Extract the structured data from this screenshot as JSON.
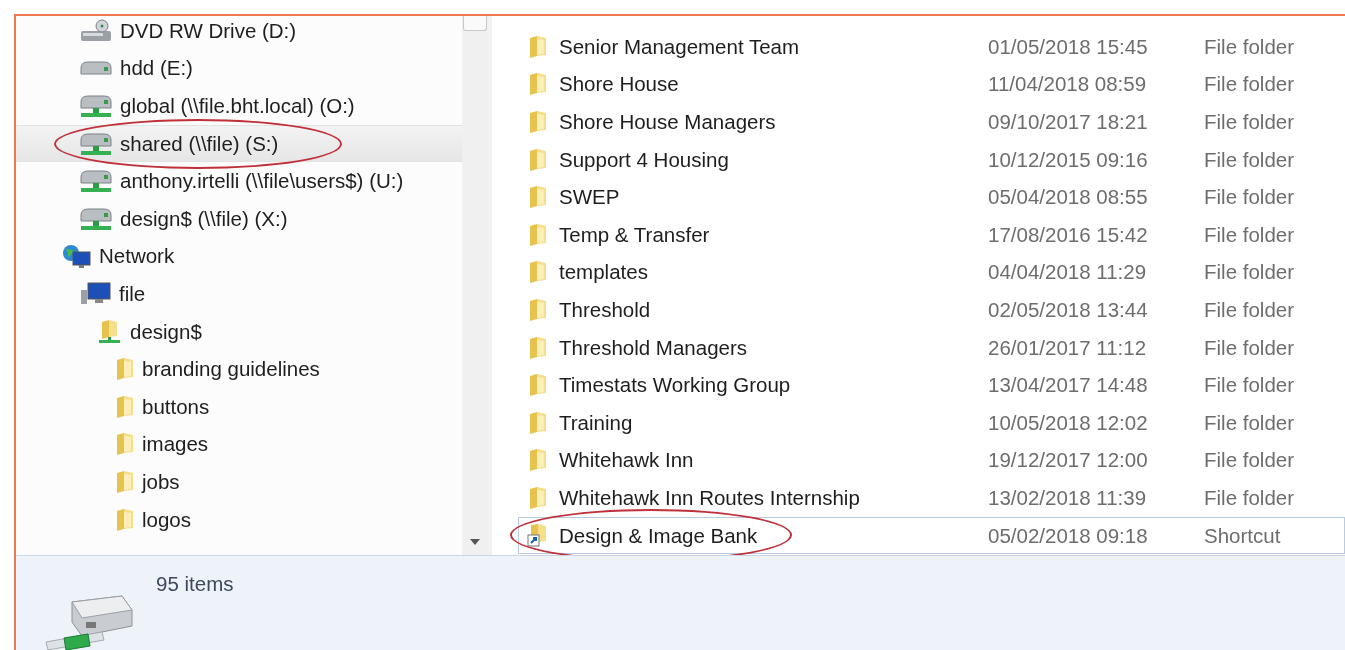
{
  "navigation_pane": {
    "drives": [
      {
        "label": "DVD RW Drive (D:)",
        "kind": "dvd",
        "selected": false,
        "annotated": false
      },
      {
        "label": "hdd (E:)",
        "kind": "hdd",
        "selected": false,
        "annotated": false
      },
      {
        "label": "global (\\\\file.bht.local) (O:)",
        "kind": "netdrive",
        "selected": false,
        "annotated": false
      },
      {
        "label": "shared (\\\\file) (S:)",
        "kind": "netdrive",
        "selected": true,
        "annotated": true
      },
      {
        "label": "anthony.irtelli (\\\\file\\users$) (U:)",
        "kind": "netdrive",
        "selected": false,
        "annotated": false
      },
      {
        "label": "design$ (\\\\file) (X:)",
        "kind": "netdrive",
        "selected": false,
        "annotated": false
      }
    ],
    "tree": [
      {
        "label": "Network",
        "kind": "network",
        "selected": false,
        "annotated": false,
        "children": [
          {
            "label": "file",
            "kind": "computer",
            "selected": false,
            "annotated": false,
            "children": [
              {
                "label": "design$",
                "kind": "share",
                "selected": false,
                "annotated": false,
                "children": [
                  {
                    "label": "branding guidelines",
                    "kind": "folder",
                    "selected": false,
                    "annotated": false
                  },
                  {
                    "label": "buttons",
                    "kind": "folder",
                    "selected": false,
                    "annotated": false
                  },
                  {
                    "label": "images",
                    "kind": "folder",
                    "selected": false,
                    "annotated": false
                  },
                  {
                    "label": "jobs",
                    "kind": "folder",
                    "selected": false,
                    "annotated": false
                  },
                  {
                    "label": "logos",
                    "kind": "folder",
                    "selected": false,
                    "annotated": false
                  }
                ]
              }
            ]
          }
        ]
      }
    ]
  },
  "file_list": {
    "rows": [
      {
        "name": "Senior Management Team",
        "date_modified": "01/05/2018 15:45",
        "type": "File folder",
        "kind": "folder",
        "selected": false,
        "annotated": false
      },
      {
        "name": "Shore House",
        "date_modified": "11/04/2018 08:59",
        "type": "File folder",
        "kind": "folder",
        "selected": false,
        "annotated": false
      },
      {
        "name": "Shore House Managers",
        "date_modified": "09/10/2017 18:21",
        "type": "File folder",
        "kind": "folder",
        "selected": false,
        "annotated": false
      },
      {
        "name": "Support 4 Housing",
        "date_modified": "10/12/2015 09:16",
        "type": "File folder",
        "kind": "folder",
        "selected": false,
        "annotated": false
      },
      {
        "name": "SWEP",
        "date_modified": "05/04/2018 08:55",
        "type": "File folder",
        "kind": "folder",
        "selected": false,
        "annotated": false
      },
      {
        "name": "Temp & Transfer",
        "date_modified": "17/08/2016 15:42",
        "type": "File folder",
        "kind": "folder",
        "selected": false,
        "annotated": false
      },
      {
        "name": "templates",
        "date_modified": "04/04/2018 11:29",
        "type": "File folder",
        "kind": "folder",
        "selected": false,
        "annotated": false
      },
      {
        "name": "Threshold",
        "date_modified": "02/05/2018 13:44",
        "type": "File folder",
        "kind": "folder",
        "selected": false,
        "annotated": false
      },
      {
        "name": "Threshold Managers",
        "date_modified": "26/01/2017 11:12",
        "type": "File folder",
        "kind": "folder",
        "selected": false,
        "annotated": false
      },
      {
        "name": "Timestats Working Group",
        "date_modified": "13/04/2017 14:48",
        "type": "File folder",
        "kind": "folder",
        "selected": false,
        "annotated": false
      },
      {
        "name": "Training",
        "date_modified": "10/05/2018 12:02",
        "type": "File folder",
        "kind": "folder",
        "selected": false,
        "annotated": false
      },
      {
        "name": "Whitehawk Inn",
        "date_modified": "19/12/2017 12:00",
        "type": "File folder",
        "kind": "folder",
        "selected": false,
        "annotated": false
      },
      {
        "name": "Whitehawk Inn Routes Internship",
        "date_modified": "13/02/2018 11:39",
        "type": "File folder",
        "kind": "folder",
        "selected": false,
        "annotated": false
      },
      {
        "name": "Design & Image Bank",
        "date_modified": "05/02/2018 09:18",
        "type": "Shortcut",
        "kind": "shortcut",
        "selected": true,
        "annotated": true
      }
    ]
  },
  "status_bar": {
    "item_count": "95 items"
  }
}
